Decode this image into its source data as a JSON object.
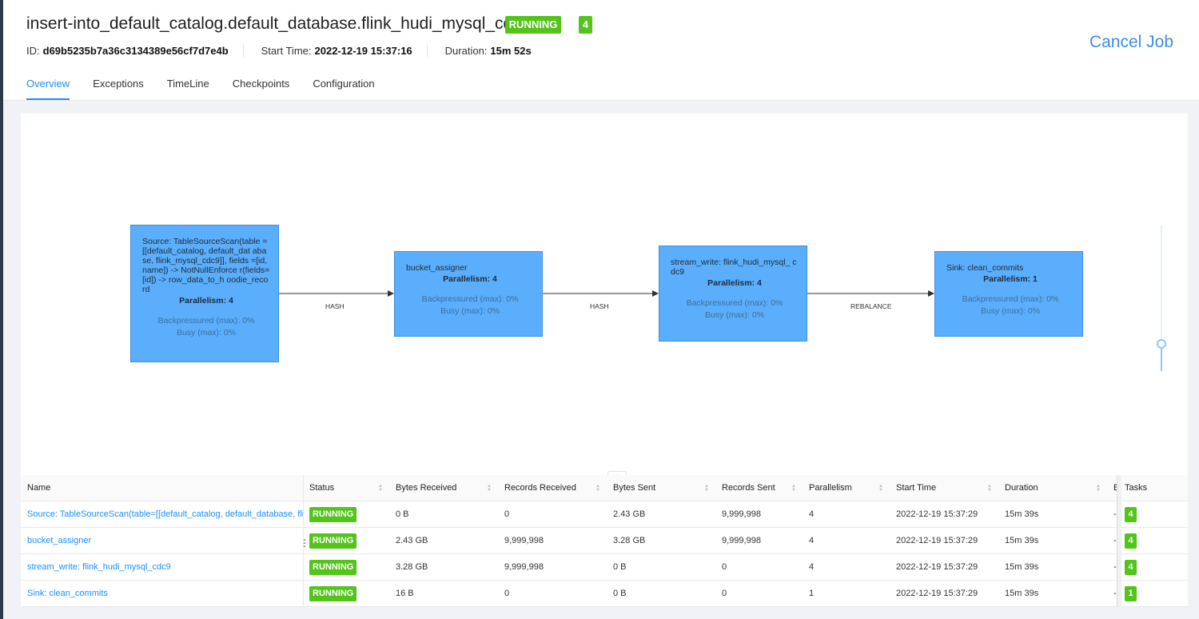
{
  "job": {
    "title": "insert-into_default_catalog.default_database.flink_hudi_mysql_cdc9",
    "status": "RUNNING",
    "task_count": "4",
    "id_label": "ID:",
    "id": "d69b5235b7a36c3134389e56cf7d7e4b",
    "start_label": "Start Time:",
    "start_time": "2022-12-19 15:37:16",
    "duration_label": "Duration:",
    "duration": "15m 52s",
    "cancel_label": "Cancel Job"
  },
  "tabs": [
    {
      "label": "Overview",
      "active": true
    },
    {
      "label": "Exceptions"
    },
    {
      "label": "TimeLine"
    },
    {
      "label": "Checkpoints"
    },
    {
      "label": "Configuration"
    }
  ],
  "graph": {
    "nodes": [
      {
        "name": "Source: TableSourceScan(table =[[default_catalog, default_dat abase, flink_mysql_cdc9]], fields =[id, name]) -> NotNullEnforce r(fields=[id]) -> row_data_to_h oodie_record",
        "parallelism": "Parallelism: 4",
        "backpressured": "Backpressured (max): 0%",
        "busy": "Busy (max): 0%"
      },
      {
        "name": "bucket_assigner",
        "parallelism": "Parallelism: 4",
        "backpressured": "Backpressured (max): 0%",
        "busy": "Busy (max): 0%"
      },
      {
        "name": "stream_write: flink_hudi_mysql_ cdc9",
        "parallelism": "Parallelism: 4",
        "backpressured": "Backpressured (max): 0%",
        "busy": "Busy (max): 0%"
      },
      {
        "name": "Sink: clean_commits",
        "parallelism": "Parallelism: 1",
        "backpressured": "Backpressured (max): 0%",
        "busy": "Busy (max): 0%"
      }
    ],
    "edges": [
      "HASH",
      "HASH",
      "REBALANCE"
    ],
    "resize_handle": "..."
  },
  "table": {
    "columns": [
      "Name",
      "Status",
      "Bytes Received",
      "Records Received",
      "Bytes Sent",
      "Records Sent",
      "Parallelism",
      "Start Time",
      "Duration",
      "E",
      "Tasks"
    ],
    "rows": [
      {
        "name": "Source: TableSourceScan(table=[[default_catalog, default_database, fli...",
        "status": "RUNNING",
        "bytes_received": "0 B",
        "records_received": "0",
        "bytes_sent": "2.43 GB",
        "records_sent": "9,999,998",
        "parallelism": "4",
        "start_time": "2022-12-19 15:37:29",
        "duration": "15m 39s",
        "end": "-",
        "tasks": "4"
      },
      {
        "name": "bucket_assigner",
        "status": "RUNNING",
        "bytes_received": "2.43 GB",
        "records_received": "9,999,998",
        "bytes_sent": "3.28 GB",
        "records_sent": "9,999,998",
        "parallelism": "4",
        "start_time": "2022-12-19 15:37:29",
        "duration": "15m 39s",
        "end": "-",
        "tasks": "4"
      },
      {
        "name": "stream_write: flink_hudi_mysql_cdc9",
        "status": "RUNNING",
        "bytes_received": "3.28 GB",
        "records_received": "9,999,998",
        "bytes_sent": "0 B",
        "records_sent": "0",
        "parallelism": "4",
        "start_time": "2022-12-19 15:37:29",
        "duration": "15m 39s",
        "end": "-",
        "tasks": "4"
      },
      {
        "name": "Sink: clean_commits",
        "status": "RUNNING",
        "bytes_received": "16 B",
        "records_received": "0",
        "bytes_sent": "0 B",
        "records_sent": "0",
        "parallelism": "1",
        "start_time": "2022-12-19 15:37:29",
        "duration": "15m 39s",
        "end": "-",
        "tasks": "1"
      }
    ],
    "row_menu": "⋮"
  },
  "colors": {
    "accent": "#1890ff",
    "running": "#52c41a",
    "node": "#5aaefc"
  }
}
